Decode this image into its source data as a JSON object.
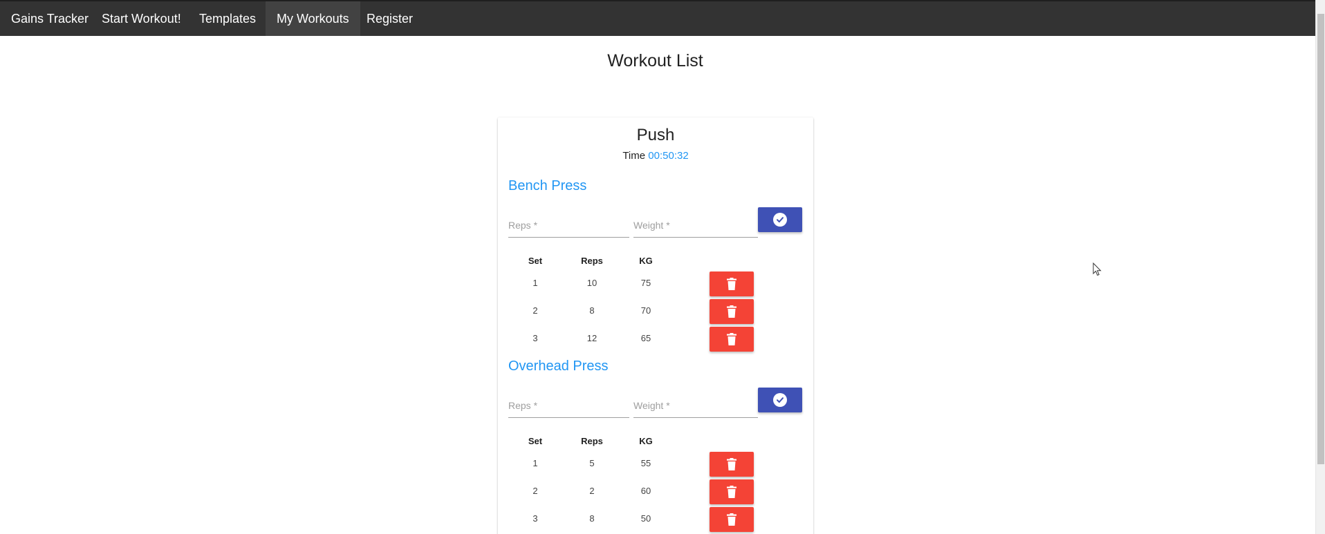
{
  "nav": {
    "items": [
      {
        "label": "Gains Tracker",
        "active": false
      },
      {
        "label": "Start Workout!",
        "active": false
      },
      {
        "label": "Templates",
        "active": false
      },
      {
        "label": "My Workouts",
        "active": true
      },
      {
        "label": "Register",
        "active": false
      }
    ]
  },
  "page": {
    "title": "Workout List"
  },
  "workout": {
    "name": "Push",
    "time_label": "Time",
    "time_value": "00:50:32",
    "exercises": [
      {
        "name": "Bench Press",
        "reps_label": "Reps *",
        "weight_label": "Weight *",
        "columns": [
          "Set",
          "Reps",
          "KG"
        ],
        "sets": [
          {
            "set": "1",
            "reps": "10",
            "kg": "75"
          },
          {
            "set": "2",
            "reps": "8",
            "kg": "70"
          },
          {
            "set": "3",
            "reps": "12",
            "kg": "65"
          }
        ]
      },
      {
        "name": "Overhead Press",
        "reps_label": "Reps *",
        "weight_label": "Weight *",
        "columns": [
          "Set",
          "Reps",
          "KG"
        ],
        "sets": [
          {
            "set": "1",
            "reps": "5",
            "kg": "55"
          },
          {
            "set": "2",
            "reps": "2",
            "kg": "60"
          },
          {
            "set": "3",
            "reps": "8",
            "kg": "50"
          }
        ]
      }
    ]
  },
  "colors": {
    "navbar": "#333333",
    "accent_blue": "#2196f3",
    "confirm_button": "#3f51b5",
    "delete_button": "#f44336"
  },
  "icons": {
    "confirm": "check-circle-icon",
    "delete": "trash-icon"
  }
}
